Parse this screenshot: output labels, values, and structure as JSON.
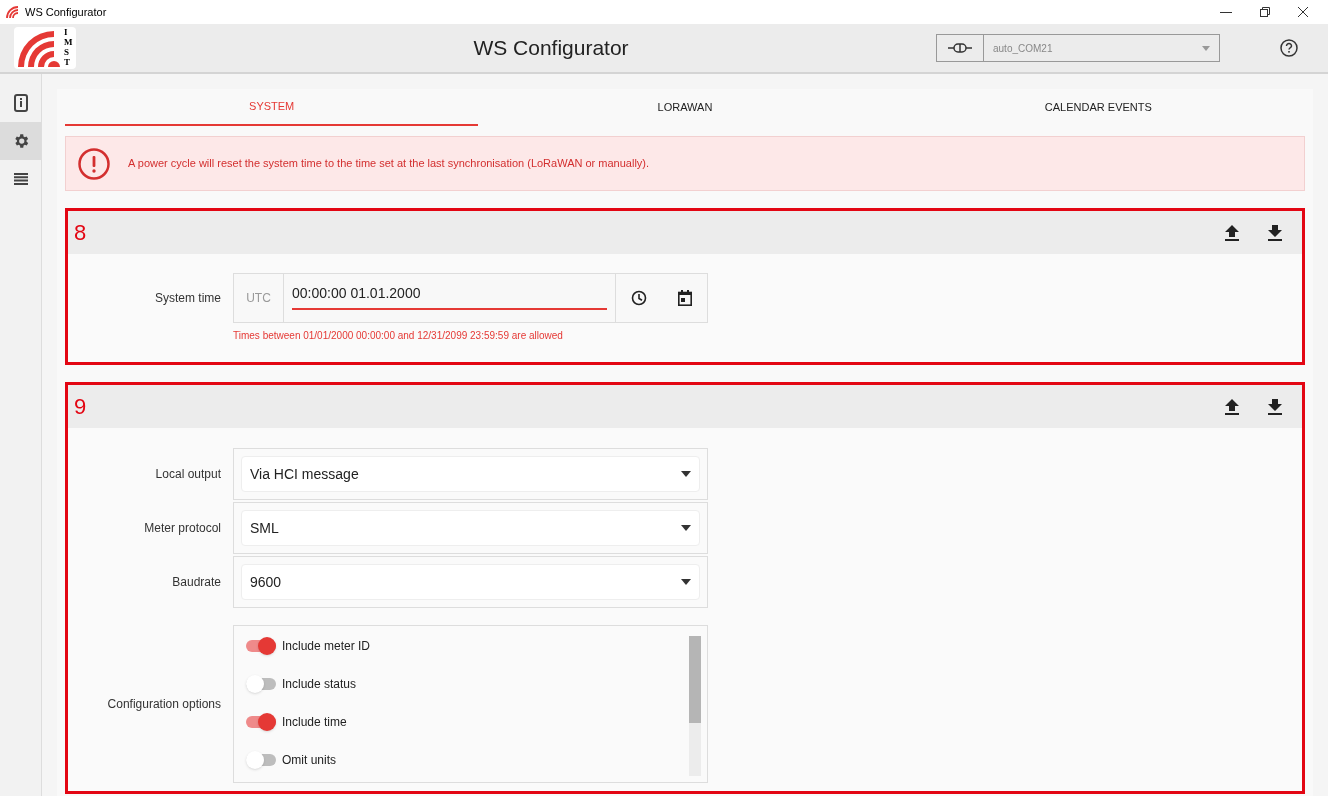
{
  "window": {
    "title": "WS Configurator",
    "logo_letters": "IMST"
  },
  "header": {
    "title": "WS Configurator",
    "port": {
      "value": "auto_COM21"
    }
  },
  "sidebar": {
    "items": [
      {
        "kind": "info",
        "selected": false
      },
      {
        "kind": "settings",
        "selected": true
      },
      {
        "kind": "list",
        "selected": false
      }
    ]
  },
  "tabs": [
    {
      "label": "SYSTEM",
      "selected": true
    },
    {
      "label": "LORAWAN",
      "selected": false
    },
    {
      "label": "CALENDAR EVENTS",
      "selected": false
    }
  ],
  "alert": {
    "text": "A power cycle will reset the system time to the time set at the last synchronisation (LoRaWAN or manually)."
  },
  "sections": [
    {
      "number": "8",
      "highlighted": true,
      "rows": [
        {
          "kind": "datetime",
          "label": "System time",
          "prefix": "UTC",
          "value": "00:00:00 01.01.2000",
          "hint": "Times between 01/01/2000 00:00:00 and 12/31/2099 23:59:59 are allowed"
        }
      ]
    },
    {
      "number": "9",
      "highlighted": true,
      "rows": [
        {
          "kind": "select",
          "label": "Local output",
          "value": "Via HCI message"
        },
        {
          "kind": "select",
          "label": "Meter protocol",
          "value": "SML"
        },
        {
          "kind": "select",
          "label": "Baudrate",
          "value": "9600"
        },
        {
          "kind": "toggles",
          "label": "Configuration options",
          "options": [
            {
              "label": "Include meter ID",
              "on": true
            },
            {
              "label": "Include status",
              "on": false
            },
            {
              "label": "Include time",
              "on": true
            },
            {
              "label": "Omit units",
              "on": false
            }
          ]
        }
      ]
    }
  ]
}
